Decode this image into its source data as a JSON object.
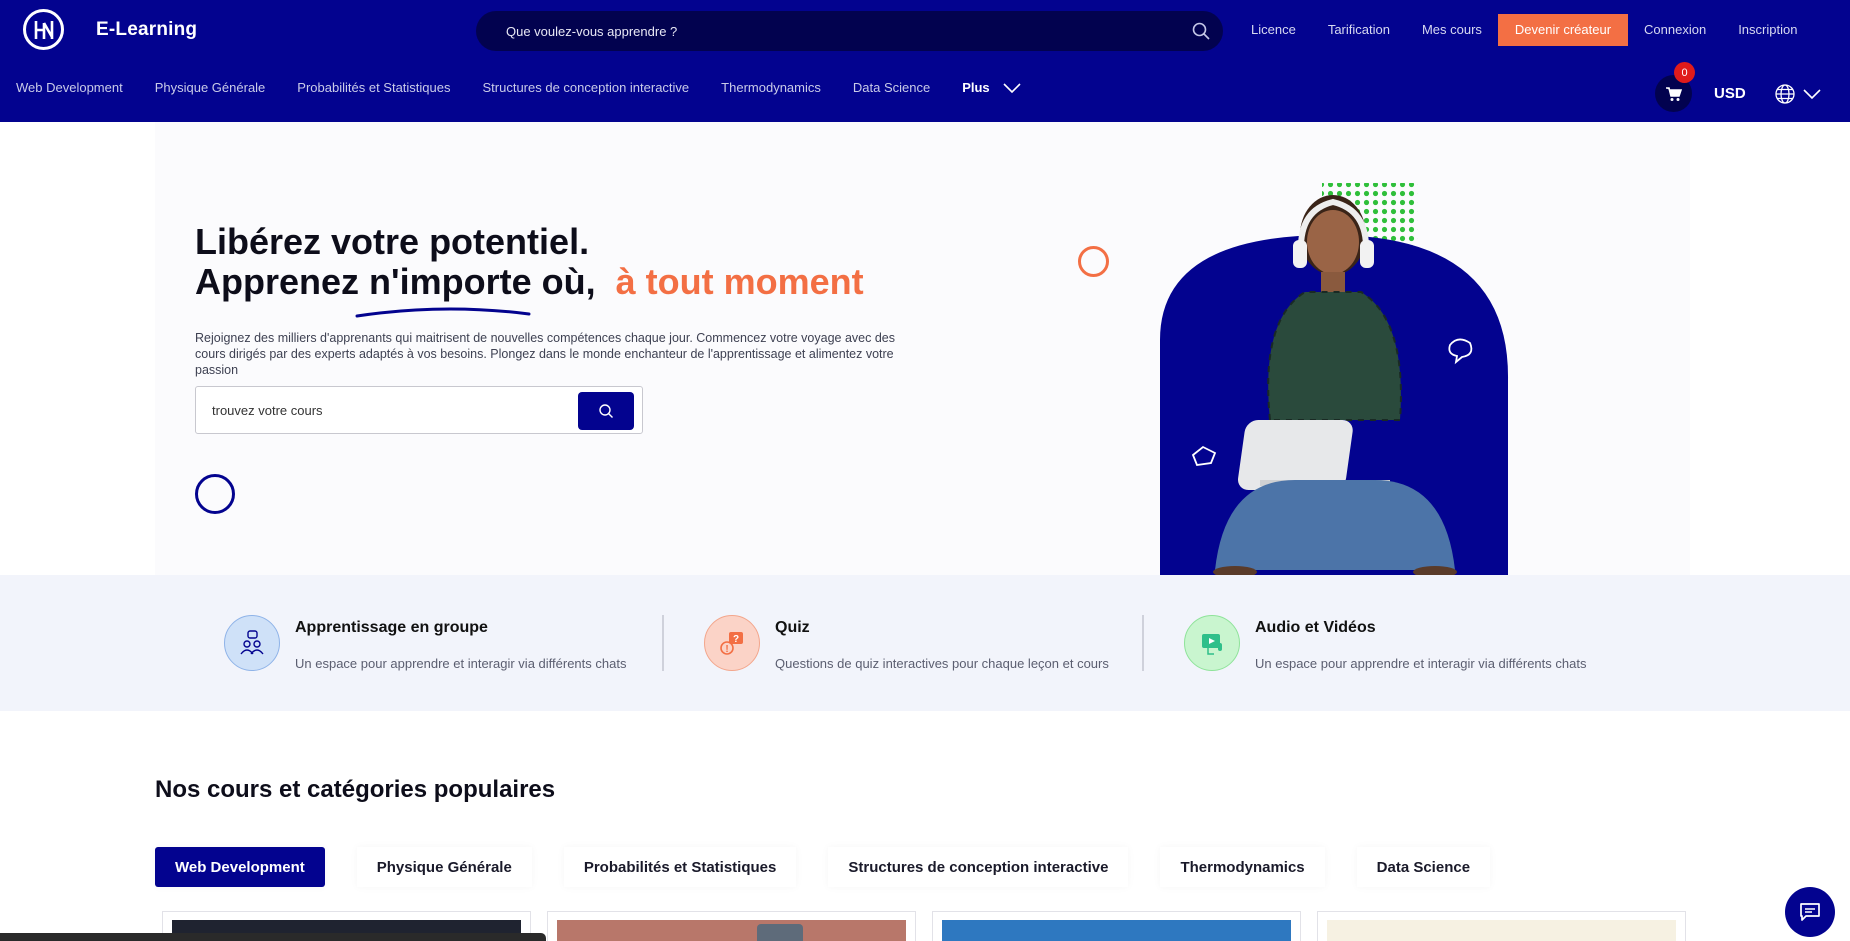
{
  "header": {
    "brand": "E-Learning",
    "logo_icon": "hn-logo",
    "search_placeholder": "Que voulez-vous apprendre ?",
    "nav": {
      "licence": "Licence",
      "pricing": "Tarification",
      "my_courses": "Mes cours",
      "become_creator": "Devenir créateur",
      "login": "Connexion",
      "signup": "Inscription"
    },
    "categories": [
      "Web Development",
      "Physique Générale",
      "Probabilités et Statistiques",
      "Structures de conception interactive",
      "Thermodynamics",
      "Data Science"
    ],
    "more_label": "Plus",
    "cart_count": "0",
    "currency": "USD"
  },
  "hero": {
    "title_line1": "Libérez votre potentiel.",
    "title_line2": "Apprenez n'importe où,",
    "title_accent": "à tout moment",
    "description": "Rejoignez des milliers d'apprenants qui maitrisent de nouvelles compétences chaque jour. Commencez votre voyage avec des cours dirigés par des experts adaptés à vos besoins. Plongez dans le monde enchanteur de l'apprentissage et alimentez votre passion",
    "search_placeholder": "trouvez votre cours"
  },
  "features": [
    {
      "title": "Apprentissage en groupe",
      "desc": "Un espace pour apprendre et interagir via différents chats",
      "icon": "group-icon"
    },
    {
      "title": "Quiz",
      "desc": "Questions de quiz interactives pour chaque leçon et cours",
      "icon": "quiz-icon"
    },
    {
      "title": "Audio et Vidéos",
      "desc": "Un espace pour apprendre et interagir via différents chats",
      "icon": "video-icon"
    }
  ],
  "popular": {
    "title": "Nos cours et catégories populaires",
    "tabs": [
      "Web Development",
      "Physique Générale",
      "Probabilités et Statistiques",
      "Structures de conception interactive",
      "Thermodynamics",
      "Data Science"
    ],
    "active_tab": "Web Development"
  },
  "colors": {
    "primary": "#03038f",
    "accent": "#f36f44",
    "features_bg": "#f2f4fb"
  }
}
